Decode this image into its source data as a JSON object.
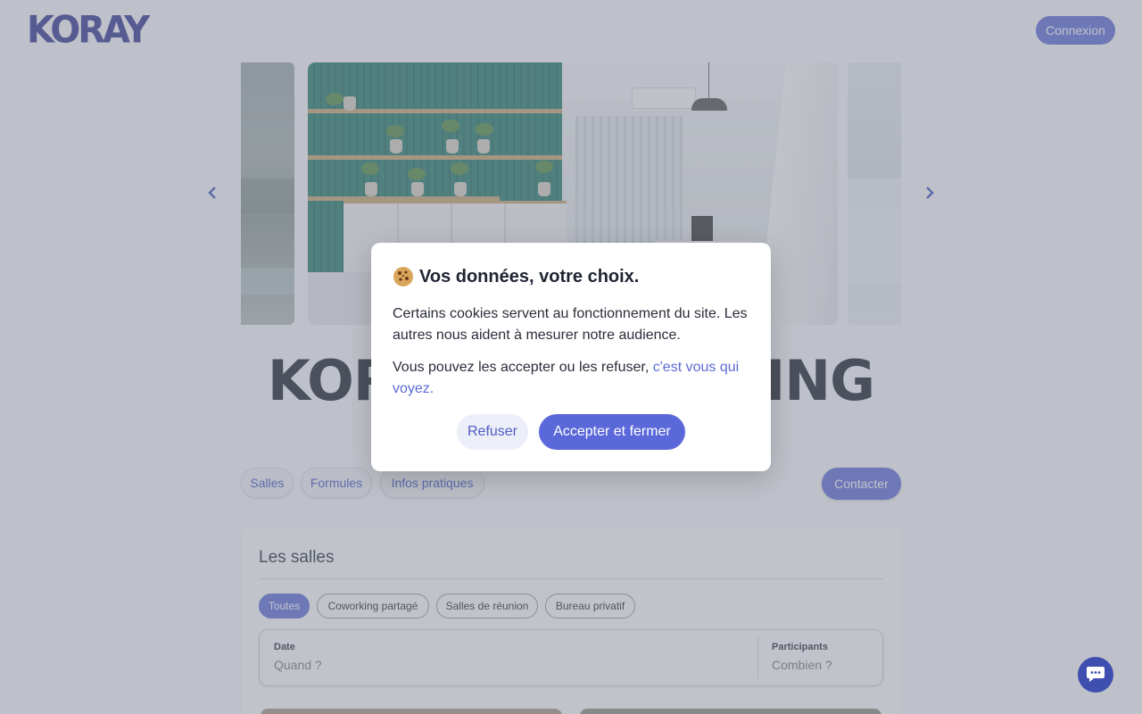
{
  "header": {
    "logo_text": "KORAY",
    "login_label": "Connexion"
  },
  "carousel": {
    "prev_icon": "chevron-left-icon",
    "next_icon": "chevron-right-icon"
  },
  "page_title": "KORAY COWORKING",
  "nav": {
    "items": [
      {
        "label": "Salles"
      },
      {
        "label": "Formules"
      },
      {
        "label": "Infos pratiques"
      }
    ],
    "contact_label": "Contacter"
  },
  "rooms": {
    "title": "Les salles",
    "filters": [
      {
        "label": "Toutes",
        "active": true
      },
      {
        "label": "Coworking partagé",
        "active": false
      },
      {
        "label": "Salles de réunion",
        "active": false
      },
      {
        "label": "Bureau privatif",
        "active": false
      }
    ],
    "search": {
      "date_label": "Date",
      "date_placeholder": "Quand ?",
      "participants_label": "Participants",
      "participants_placeholder": "Combien ?"
    }
  },
  "cookie_modal": {
    "title": "Vos données, votre choix.",
    "icon": "cookie-icon",
    "text_1": "Certains cookies servent au fonctionnement du site. Les autres nous aident à mesurer notre audience.",
    "text_2_prefix": "Vous pouvez les accepter ou les refuser, ",
    "text_2_link": "c'est vous qui voyez.",
    "refuse_label": "Refuser",
    "accept_label": "Accepter et fermer"
  },
  "chat": {
    "icon": "chat-bubble-icon"
  },
  "colors": {
    "accent": "#5b68d9",
    "logo": "#2b2f8e",
    "link": "#5d6bd4"
  }
}
